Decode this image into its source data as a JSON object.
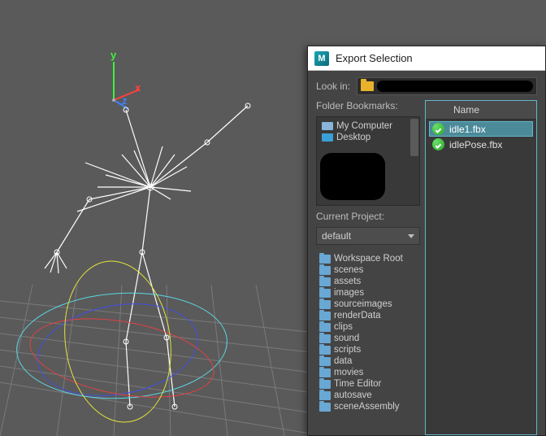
{
  "axis": {
    "y": "y",
    "x": "x",
    "z": "z"
  },
  "dialog": {
    "title": "Export Selection",
    "lookin_label": "Look in:",
    "bookmarks_label": "Folder Bookmarks:",
    "bookmarks": [
      {
        "label": "My Computer",
        "icon": "drive-icon"
      },
      {
        "label": "Desktop",
        "icon": "monitor-icon"
      }
    ],
    "current_project_label": "Current Project:",
    "current_project_value": "default",
    "project_folders": [
      "Workspace Root",
      "scenes",
      "assets",
      "images",
      "sourceimages",
      "renderData",
      "clips",
      "sound",
      "scripts",
      "data",
      "movies",
      "Time Editor",
      "autosave",
      "sceneAssembly"
    ],
    "name_header": "Name",
    "files": [
      {
        "name": "idle1.fbx",
        "selected": true
      },
      {
        "name": "idlePose.fbx",
        "selected": false
      }
    ]
  }
}
